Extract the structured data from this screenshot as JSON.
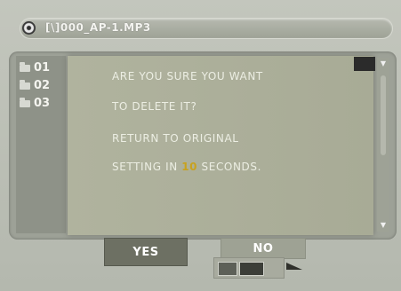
{
  "header": {
    "file_title": "[\\]000_AP-1.MP3"
  },
  "list": {
    "items": [
      {
        "label": "01",
        "icon": "folder-icon"
      },
      {
        "label": "02",
        "icon": "folder-icon"
      },
      {
        "label": "03",
        "icon": "folder-icon"
      }
    ]
  },
  "dialog": {
    "line1": "ARE YOU SURE YOU WANT",
    "line2": "TO DELETE IT?",
    "line3": "RETURN TO ORIGINAL",
    "line4_prefix": "SETTING IN ",
    "countdown": "10",
    "line4_suffix": " SECONDS."
  },
  "buttons": {
    "yes": "YES",
    "no": "NO"
  },
  "colors": {
    "countdown": "#c8a21e",
    "selected_button": "#6d7063"
  }
}
